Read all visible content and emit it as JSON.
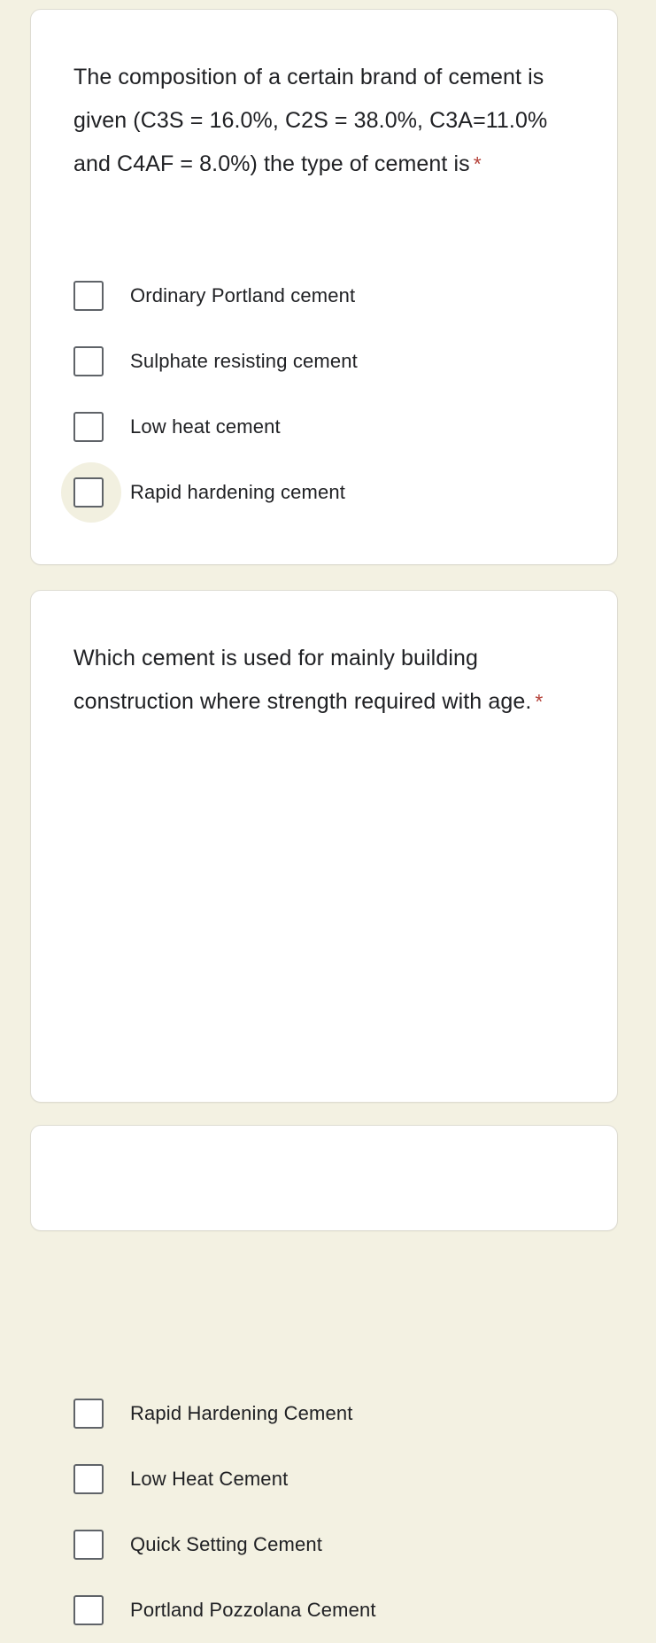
{
  "page": {
    "background_color": "#f3f1e2",
    "card_background_color": "#ffffff",
    "text_color": "#202124",
    "required_marker_color": "#b5423a",
    "checkbox_border_color": "#5f6368",
    "hover_highlight_color": "#f2f0e0"
  },
  "questions": [
    {
      "id": "q1",
      "text": "The composition of a certain brand of cement is given (C3S = 16.0%, C2S = 38.0%, C3A=11.0% and C4AF = 8.0%) the type of cement is",
      "required_marker": "*",
      "options": [
        {
          "label": "Ordinary Portland cement",
          "checked": false,
          "hovered": false
        },
        {
          "label": "Sulphate resisting cement",
          "checked": false,
          "hovered": false
        },
        {
          "label": "Low heat cement",
          "checked": false,
          "hovered": false
        },
        {
          "label": "Rapid hardening cement",
          "checked": false,
          "hovered": true
        }
      ]
    },
    {
      "id": "q2",
      "text": "Which cement is used for mainly building construction where strength required with age.",
      "required_marker": "*",
      "options": [
        {
          "label": "Rapid Hardening Cement",
          "checked": false,
          "hovered": false
        },
        {
          "label": "Low Heat Cement",
          "checked": false,
          "hovered": false
        },
        {
          "label": "Quick Setting Cement",
          "checked": false,
          "hovered": false
        },
        {
          "label": "Portland Pozzolana Cement",
          "checked": false,
          "hovered": false
        }
      ]
    },
    {
      "id": "q3",
      "text": "",
      "required_marker": "",
      "options": []
    }
  ]
}
